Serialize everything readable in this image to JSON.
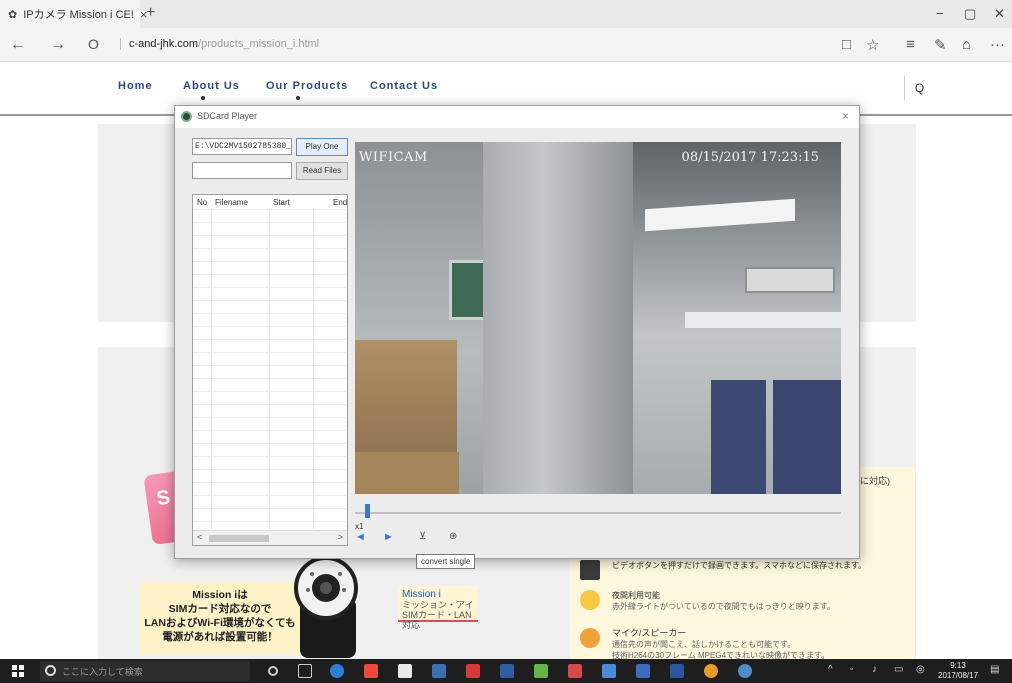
{
  "browser": {
    "tab_title": "IPカメラ  Mission i CE!",
    "tab_close": "×",
    "new_tab": "+",
    "url_domain": "c-and-jhk.com",
    "url_path": "/products_mission_i.html",
    "back": "←",
    "forward": "→",
    "refresh": "O",
    "reading_view": "□",
    "favorite": "☆",
    "hub": "≡",
    "notes": "✎",
    "share": "⌂",
    "more": "···",
    "minimize": "−",
    "restore": "▢",
    "close": "✕"
  },
  "site": {
    "nav": [
      "Home",
      "About Us",
      "Our Products",
      "Contact Us"
    ],
    "search_icon": "Q",
    "pink_letter": "S",
    "side_note": "に対応)",
    "mission_card": [
      "Mission iは",
      "SIMカード対応なので",
      "LANおよびWi-Fi環境がなくても",
      "電源があれば設置可能！"
    ],
    "mission_small": [
      "Mission i",
      "ミッション・アイ",
      "SIMカード・LAN対応"
    ],
    "features": [
      {
        "title": "ビデオボタンを押すだけで録画できます。スマホなどに保存されます。",
        "sub": ""
      },
      {
        "title": "夜間利用可能",
        "sub": "赤外線ライトがついているので夜間でもはっきりと映ります。"
      },
      {
        "title": "マイク/スピーカー",
        "sub": "通信先の声が聞こえ、話しかけることも可能です。"
      },
      {
        "title": "",
        "sub": "技術H264の30フレーム MPEG4できれいな映像ができます。"
      }
    ]
  },
  "player": {
    "title": "SDCard Player",
    "close": "×",
    "path_value": "E:\\VDC2MV1502785380_1.264",
    "play_one": "Play One",
    "read_files": "Read Files",
    "columns": [
      "No",
      "Filename",
      "Start",
      "End"
    ],
    "scroll_left": "<",
    "scroll_right": ">",
    "osd_left": "WIFICAM",
    "osd_right": "08/15/2017 17:23:15",
    "speed": "x1",
    "tooltip": "convert single",
    "controls": {
      "rewind": "◄",
      "forward": "►",
      "convert": "⊻",
      "snapshot": "⊕"
    },
    "seek_position": 0.02
  },
  "taskbar": {
    "search_placeholder": "ここに入力して検索",
    "time": "9:13",
    "date": "2017/08/17"
  },
  "colors": {
    "site_nav_text": "#2e4a7a",
    "accent_blue": "#3b78c4",
    "taskbar": "#1e1e1e"
  }
}
